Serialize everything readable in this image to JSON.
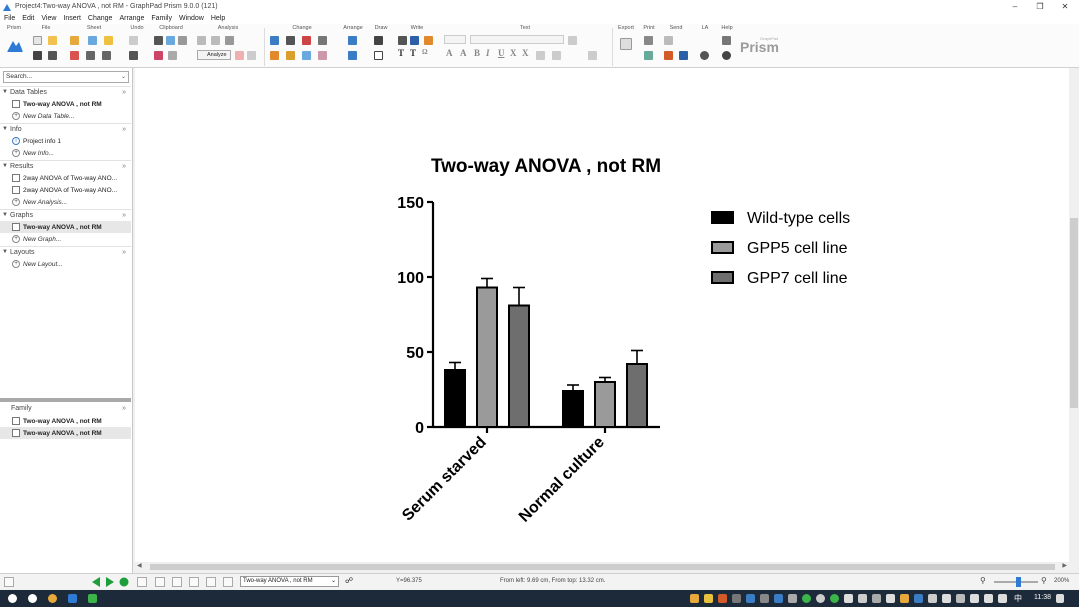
{
  "window": {
    "title": "Project4:Two-way ANOVA , not RM - GraphPad Prism 9.0.0 (121)",
    "minimize_icon": "minimize-icon",
    "maximize_icon": "restore-icon",
    "close_icon": "close-icon"
  },
  "menu": [
    "File",
    "Edit",
    "View",
    "Insert",
    "Change",
    "Arrange",
    "Family",
    "Window",
    "Help"
  ],
  "ribbon": {
    "groups": [
      "Prism",
      "File",
      "Sheet",
      "Undo",
      "Clipboard",
      "Analysis",
      "Change",
      "Arrange",
      "Draw",
      "Write",
      "Text",
      "Export",
      "Print",
      "Send",
      "LA",
      "Help"
    ],
    "analyze_label": "Analyze",
    "brand": "Prism",
    "brand_small": "GraphPad"
  },
  "navigator": {
    "search_placeholder": "Search...",
    "sections": [
      {
        "title": "Data Tables",
        "items": [
          {
            "label": "Two-way ANOVA , not RM",
            "bold": true
          },
          {
            "label": "New Data Table...",
            "new": true
          }
        ]
      },
      {
        "title": "Info",
        "items": [
          {
            "label": "Project info 1"
          },
          {
            "label": "New Info...",
            "new": true
          }
        ]
      },
      {
        "title": "Results",
        "items": [
          {
            "label": "2way ANOVA of Two-way ANO..."
          },
          {
            "label": "2way ANOVA of Two-way ANO..."
          },
          {
            "label": "New Analysis...",
            "new": true
          }
        ]
      },
      {
        "title": "Graphs",
        "items": [
          {
            "label": "Two-way ANOVA , not RM",
            "bold": true,
            "selected": true
          },
          {
            "label": "New Graph...",
            "new": true
          }
        ]
      },
      {
        "title": "Layouts",
        "items": [
          {
            "label": "New Layout...",
            "new": true
          }
        ]
      }
    ],
    "family": {
      "title": "Family",
      "items": [
        "Two-way ANOVA , not RM",
        "Two-way ANOVA , not RM"
      ]
    }
  },
  "chart_data": {
    "type": "bar",
    "title": "Two-way ANOVA , not RM",
    "categories": [
      "Serum starved",
      "Normal culture"
    ],
    "series": [
      {
        "name": "Wild-type cells",
        "values": [
          38,
          24
        ],
        "errors": [
          5,
          4
        ],
        "color": "#000000"
      },
      {
        "name": "GPP5 cell line",
        "values": [
          93,
          30
        ],
        "errors": [
          6,
          3
        ],
        "color": "#9a9a9a"
      },
      {
        "name": "GPP7 cell line",
        "values": [
          81,
          42
        ],
        "errors": [
          12,
          9
        ],
        "color": "#6e6e6e"
      }
    ],
    "ylim": [
      0,
      150
    ],
    "yticks": [
      0,
      50,
      100,
      150
    ],
    "legend_position": "top-right",
    "grid": false
  },
  "statusbar": {
    "sheet_select": "Two-way ANOVA , not RM",
    "y_readout": "Y=96.375",
    "position_readout": "From left: 9.69 cm, From top: 13.32 cm.",
    "zoom": "200%",
    "zoom_level": 0.55
  },
  "taskbar": {
    "time": "11:38",
    "ime": "中"
  }
}
